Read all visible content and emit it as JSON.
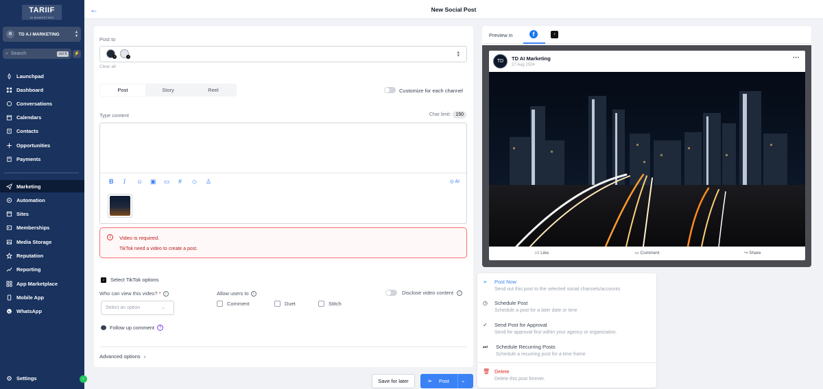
{
  "colors": {
    "sidebar_bg": "#19325e",
    "accent": "#3b82f6",
    "error": "#dc2626",
    "facebook": "#1877f2"
  },
  "sidebar": {
    "logo": "TARIIF",
    "logo_sub": "AI MARKETING",
    "account": "TD A.I MARKETING",
    "search_placeholder": "Search",
    "search_shortcut": "ctrl K",
    "items": [
      {
        "label": "Launchpad",
        "icon": "rocket-icon"
      },
      {
        "label": "Dashboard",
        "icon": "grid-icon"
      },
      {
        "label": "Conversations",
        "icon": "chat-icon"
      },
      {
        "label": "Calendars",
        "icon": "calendar-icon"
      },
      {
        "label": "Contacts",
        "icon": "contacts-icon"
      },
      {
        "label": "Opportunities",
        "icon": "opportunities-icon"
      },
      {
        "label": "Payments",
        "icon": "payments-icon"
      },
      {
        "label": "Marketing",
        "icon": "send-icon",
        "active": true
      },
      {
        "label": "Automation",
        "icon": "automation-icon"
      },
      {
        "label": "Sites",
        "icon": "sites-icon"
      },
      {
        "label": "Memberships",
        "icon": "memberships-icon"
      },
      {
        "label": "Media Storage",
        "icon": "media-icon"
      },
      {
        "label": "Reputation",
        "icon": "star-icon"
      },
      {
        "label": "Reporting",
        "icon": "chart-icon"
      },
      {
        "label": "App Marketplace",
        "icon": "apps-icon"
      },
      {
        "label": "Mobile App",
        "icon": "mobile-icon"
      },
      {
        "label": "WhatsApp",
        "icon": "whatsapp-icon"
      }
    ],
    "settings": "Settings"
  },
  "header": {
    "title": "New Social Post"
  },
  "composer": {
    "post_to_label": "Post to",
    "clear_all": "Clear all",
    "post_types": [
      "Post",
      "Story",
      "Reel"
    ],
    "customize_label": "Customize for each channel",
    "content_label": "Type content",
    "char_limit_label": "Char limit:",
    "char_limit_value": "150",
    "ai_label": "AI",
    "error_title": "Video is required.",
    "error_desc": "TikTok need a video to create a post.",
    "tiktok_options": "Select TikTok options",
    "who_can_view": "Who can view this video?",
    "required_mark": "*",
    "select_placeholder": "Select an option",
    "allow_users": "Allow users to",
    "allow_options": [
      "Comment",
      "Duet",
      "Stitch"
    ],
    "disclose": "Disclose video content",
    "follow_up": "Follow up comment",
    "advanced": "Advanced options"
  },
  "actions": {
    "save_later": "Save for later",
    "post": "Post"
  },
  "preview": {
    "label": "Preview in",
    "page_name": "TD AI Marketing",
    "date": "27 Aug 2024",
    "avatar_text": "TD",
    "like": "Like",
    "comment": "Comment",
    "share": "Share"
  },
  "post_menu": [
    {
      "title": "Post Now",
      "desc": "Send out this post to the selected social channels/accounts",
      "icon": "send-icon",
      "color": "#3b82f6"
    },
    {
      "title": "Schedule Post",
      "desc": "Schedule a post for a later date or time",
      "icon": "clock-icon",
      "color": "#374151"
    },
    {
      "title": "Send Post for Approval",
      "desc": "Send for approval first within your agency or organization.",
      "icon": "check-circle-icon",
      "color": "#374151"
    },
    {
      "title": "Schedule Recurring Posts",
      "desc": "Schedule a recurring post for a time frame",
      "icon": "recurring-icon",
      "color": "#374151"
    },
    {
      "title": "Delete",
      "desc": "Delete this post forever.",
      "icon": "trash-icon",
      "color": "#dc2626"
    }
  ]
}
